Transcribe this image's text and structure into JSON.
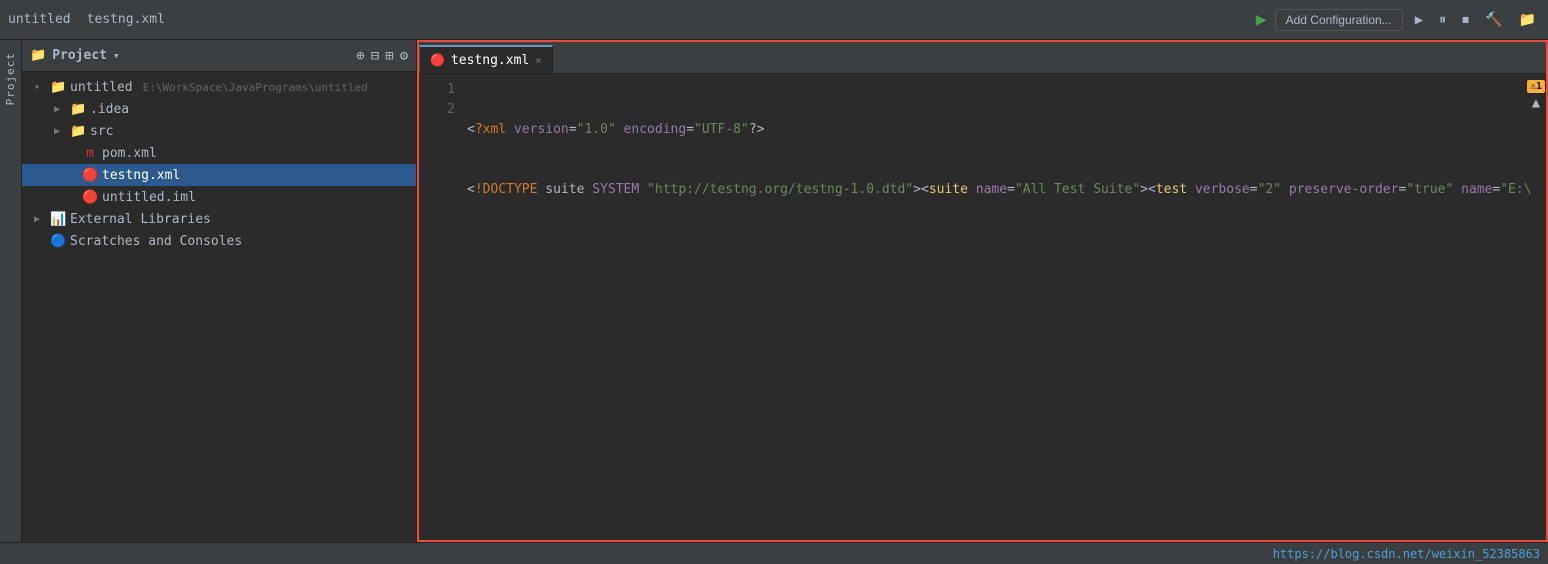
{
  "app": {
    "title": "untitled",
    "tab_filename": "testng.xml",
    "tab_close_label": "×"
  },
  "toolbar": {
    "add_config_label": "Add Configuration...",
    "run_icon": "▶",
    "icons": [
      "▶",
      "⏸",
      "⏹",
      "🔨",
      "📁"
    ]
  },
  "sidebar": {
    "title": "Project",
    "arrow": "▾",
    "strip_label": "Project",
    "project_path": "E:\\WorkSpace\\JavaPrograms\\untitled",
    "items": [
      {
        "label": "untitled",
        "type": "root",
        "path": "E:\\WorkSpace\\JavaPrograms\\untitled",
        "indent": 0,
        "expanded": true
      },
      {
        "label": ".idea",
        "type": "folder",
        "indent": 1,
        "expanded": false
      },
      {
        "label": "src",
        "type": "folder",
        "indent": 1,
        "expanded": false
      },
      {
        "label": "pom.xml",
        "type": "maven",
        "indent": 1
      },
      {
        "label": "testng.xml",
        "type": "xml",
        "indent": 1,
        "selected": true
      },
      {
        "label": "untitled.iml",
        "type": "iml",
        "indent": 1
      },
      {
        "label": "External Libraries",
        "type": "extlibs",
        "indent": 0,
        "expanded": false
      },
      {
        "label": "Scratches and Consoles",
        "type": "scratch",
        "indent": 0
      }
    ]
  },
  "editor": {
    "tab_label": "testng.xml",
    "lines": [
      {
        "num": "1",
        "content": "<?xml version=\"1.0\" encoding=\"UTF-8\"?>"
      },
      {
        "num": "2",
        "content": "<!DOCTYPE suite SYSTEM \"http://testng.org/testng-1.0.dtd\"><suite name=\"All Test Suite\"><test verbose=\"2\" preserve-order=\"true\" name=\"E:\\"
      }
    ],
    "warning_count": "1"
  },
  "bottom_bar": {
    "url": "https://blog.csdn.net/weixin_52385863"
  }
}
